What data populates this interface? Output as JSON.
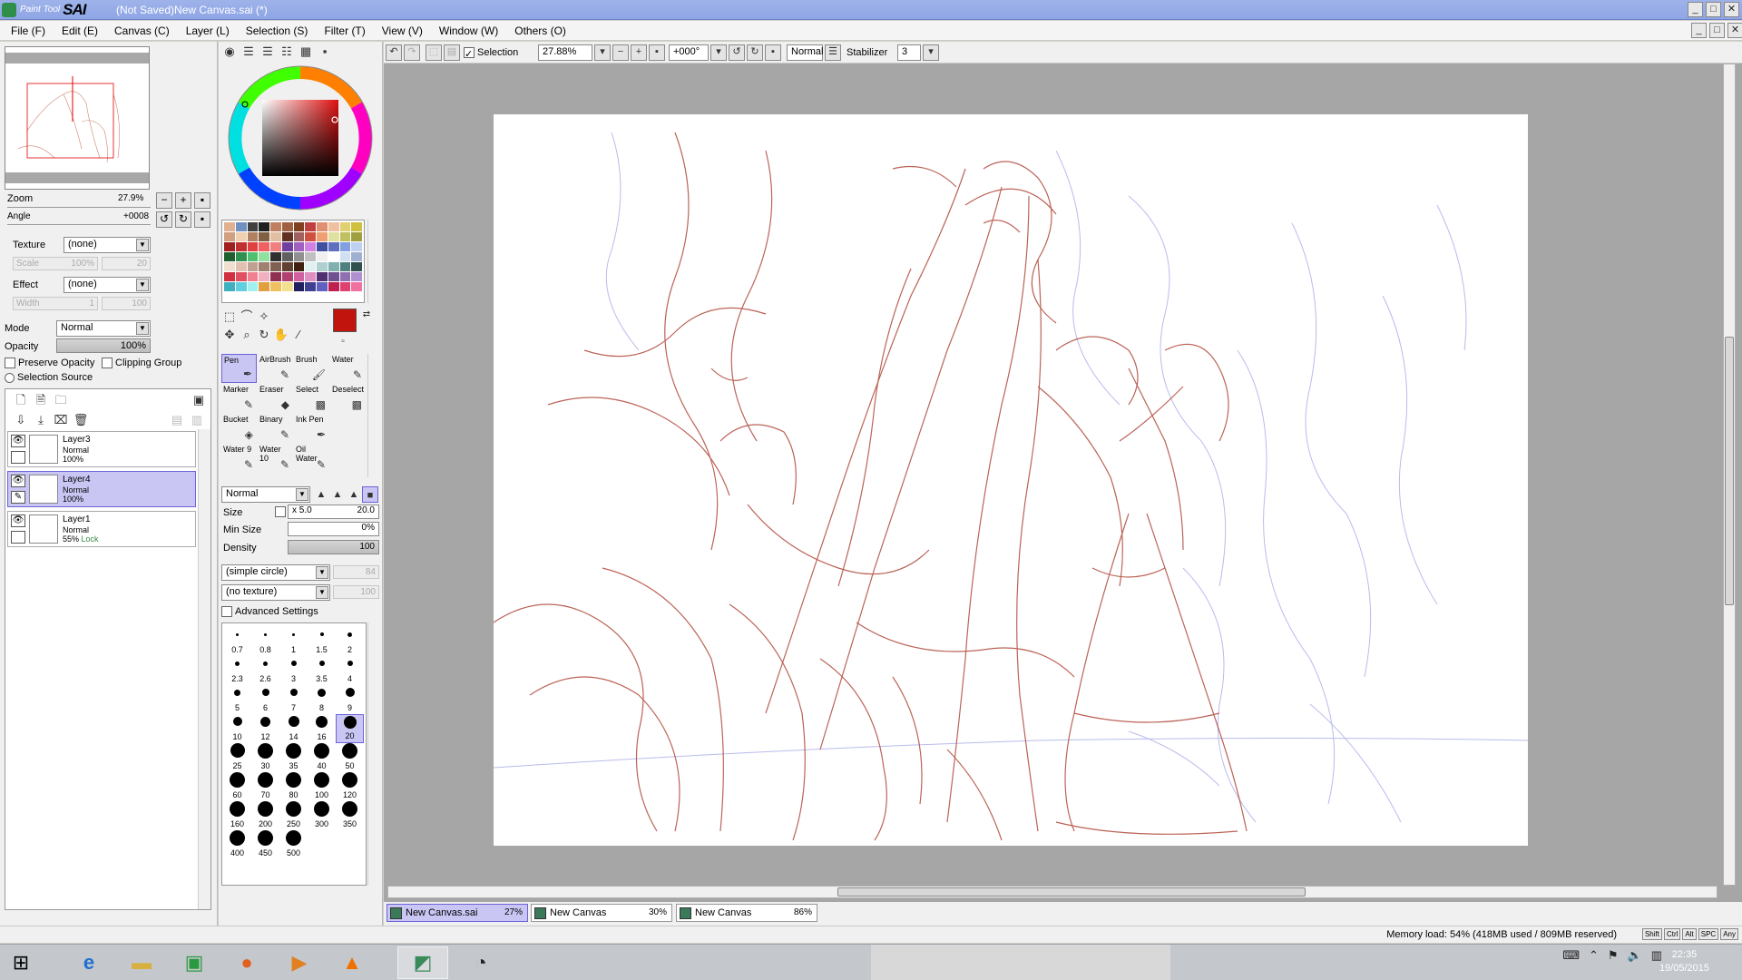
{
  "app": {
    "logo_small": "Paint Tool",
    "logo_big": "SAI",
    "title": "(Not Saved)New Canvas.sai (*)"
  },
  "menu": [
    "File (F)",
    "Edit (E)",
    "Canvas (C)",
    "Layer (L)",
    "Selection (S)",
    "Filter (T)",
    "View (V)",
    "Window (W)",
    "Others (O)"
  ],
  "navigator": {
    "zoom_label": "Zoom",
    "zoom_value": "27.9%",
    "angle_label": "Angle",
    "angle_value": "+0008"
  },
  "layer_props": {
    "texture_label": "Texture",
    "texture_value": "(none)",
    "scale_label": "Scale",
    "scale_value": "100%",
    "scale_num": "20",
    "effect_label": "Effect",
    "effect_value": "(none)",
    "width_label": "Width",
    "width_value": "1",
    "width_num": "100",
    "mode_label": "Mode",
    "mode_value": "Normal",
    "opacity_label": "Opacity",
    "opacity_value": "100%",
    "preserve_opacity": "Preserve Opacity",
    "clipping_group": "Clipping Group",
    "selection_source": "Selection Source"
  },
  "layers": [
    {
      "name": "Layer3",
      "mode": "Normal",
      "opacity": "100%",
      "lock": ""
    },
    {
      "name": "Layer4",
      "mode": "Normal",
      "opacity": "100%",
      "lock": ""
    },
    {
      "name": "Layer1",
      "mode": "Normal",
      "opacity": "55%",
      "lock": "Lock"
    }
  ],
  "swatch_colors": [
    "#e0b090",
    "#7090c0",
    "#404040",
    "#202020",
    "#c08060",
    "#a06040",
    "#804020",
    "#c04040",
    "#e09070",
    "#f0c0a0",
    "#e0d070",
    "#d0c040",
    "#d0a080",
    "#f0d0b0",
    "#b08060",
    "#806040",
    "#e0c0a0",
    "#603020",
    "#a06060",
    "#d05040",
    "#f0a070",
    "#e0e0a0",
    "#c0c060",
    "#a0a040",
    "#a02020",
    "#c03030",
    "#e04040",
    "#f06060",
    "#f08080",
    "#7040a0",
    "#a060c0",
    "#d080e0",
    "#4050a0",
    "#6070c0",
    "#80a0e0",
    "#c0d0f0",
    "#206030",
    "#309050",
    "#50c070",
    "#90e0a0",
    "#303030",
    "#606060",
    "#909090",
    "#c0c0c0",
    "#f0f0f0",
    "#ffffff",
    "#d0e0f0",
    "#a0b0d0",
    "#f0e0d0",
    "#e0c0b0",
    "#c0a090",
    "#a08070",
    "#806050",
    "#604030",
    "#402010",
    "#e0f0f0",
    "#b0d0d0",
    "#80b0b0",
    "#508080",
    "#305050",
    "#d03040",
    "#e05060",
    "#f08090",
    "#f0b0c0",
    "#903050",
    "#b04070",
    "#d060a0",
    "#e090c0",
    "#503070",
    "#705090",
    "#9070b0",
    "#b090d0",
    "#40b0c0",
    "#60d0e0",
    "#a0f0f0",
    "#e0a040",
    "#f0c060",
    "#f0e090",
    "#202060",
    "#404090",
    "#6060c0",
    "#c02050",
    "#e04070",
    "#f070a0"
  ],
  "tools": [
    {
      "name": "Pen",
      "icon": "pen-icon",
      "glyph": "✒"
    },
    {
      "name": "AirBrush",
      "icon": "airbrush-icon",
      "glyph": "✎"
    },
    {
      "name": "Brush",
      "icon": "brush-icon",
      "glyph": "🖌"
    },
    {
      "name": "Water",
      "icon": "water-brush-icon",
      "glyph": "✎"
    },
    {
      "name": "Marker",
      "icon": "marker-icon",
      "glyph": "✎"
    },
    {
      "name": "Eraser",
      "icon": "eraser-icon",
      "glyph": "◆"
    },
    {
      "name": "Select",
      "icon": "select-icon",
      "glyph": "▩"
    },
    {
      "name": "Deselect",
      "icon": "deselect-icon",
      "glyph": "▩"
    },
    {
      "name": "Bucket",
      "icon": "bucket-icon",
      "glyph": "◈"
    },
    {
      "name": "Binary",
      "icon": "binary-icon",
      "glyph": "✎"
    },
    {
      "name": "Ink Pen",
      "icon": "ink-pen-icon",
      "glyph": "✒"
    },
    {
      "name": "",
      "icon": "empty-slot-icon",
      "glyph": ""
    },
    {
      "name": "Water 9",
      "icon": "water-icon",
      "glyph": "✎"
    },
    {
      "name": "Water 10",
      "icon": "water-icon",
      "glyph": "✎"
    },
    {
      "name": "Oil Water",
      "icon": "oil-water-icon",
      "glyph": "✎"
    },
    {
      "name": "",
      "icon": "empty-slot-icon",
      "glyph": ""
    }
  ],
  "brush_settings": {
    "blend_mode": "Normal",
    "size_label": "Size",
    "size_mult": "x 5.0",
    "size_value": "20.0",
    "minsize_label": "Min Size",
    "minsize_value": "0%",
    "density_label": "Density",
    "density_value": "100",
    "shape": "(simple circle)",
    "shape_num": "84",
    "texture": "(no texture)",
    "texture_num": "100",
    "advanced": "Advanced Settings"
  },
  "brush_sizes": [
    "0.7",
    "0.8",
    "1",
    "1.5",
    "2",
    "2.3",
    "2.6",
    "3",
    "3.5",
    "4",
    "5",
    "6",
    "7",
    "8",
    "9",
    "10",
    "12",
    "14",
    "16",
    "20",
    "25",
    "30",
    "35",
    "40",
    "50",
    "60",
    "70",
    "80",
    "100",
    "120",
    "160",
    "200",
    "250",
    "300",
    "350",
    "400",
    "450",
    "500"
  ],
  "canvas_toolbar": {
    "selection_label": "Selection",
    "zoom": "27.88%",
    "angle": "+000°",
    "blend": "Normal",
    "stabilizer_label": "Stabilizer",
    "stabilizer_value": "3"
  },
  "doc_tabs": [
    {
      "name": "New Canvas.sai",
      "zoom": "27%"
    },
    {
      "name": "New Canvas",
      "zoom": "30%"
    },
    {
      "name": "New Canvas",
      "zoom": "86%"
    }
  ],
  "status": {
    "memory": "Memory load: 54% (418MB used / 809MB reserved)",
    "keys": [
      "Shift",
      "Ctrl",
      "Alt",
      "SPC",
      "Any"
    ]
  },
  "taskbar": {
    "time": "22:35",
    "date": "19/05/2015",
    "apps": [
      "start-icon",
      "ie-icon",
      "explorer-icon",
      "store-icon",
      "firefox-icon",
      "media-player-icon",
      "vlc-icon",
      "paint-tool-sai-icon",
      "speed-icon"
    ]
  },
  "colors": {
    "primary": "#c0140c",
    "secondary": "#ffffff",
    "selection_highlight": "#c9c6f4",
    "sketch_red": "#b0483a",
    "sketch_blue": "#8a8fe0"
  }
}
